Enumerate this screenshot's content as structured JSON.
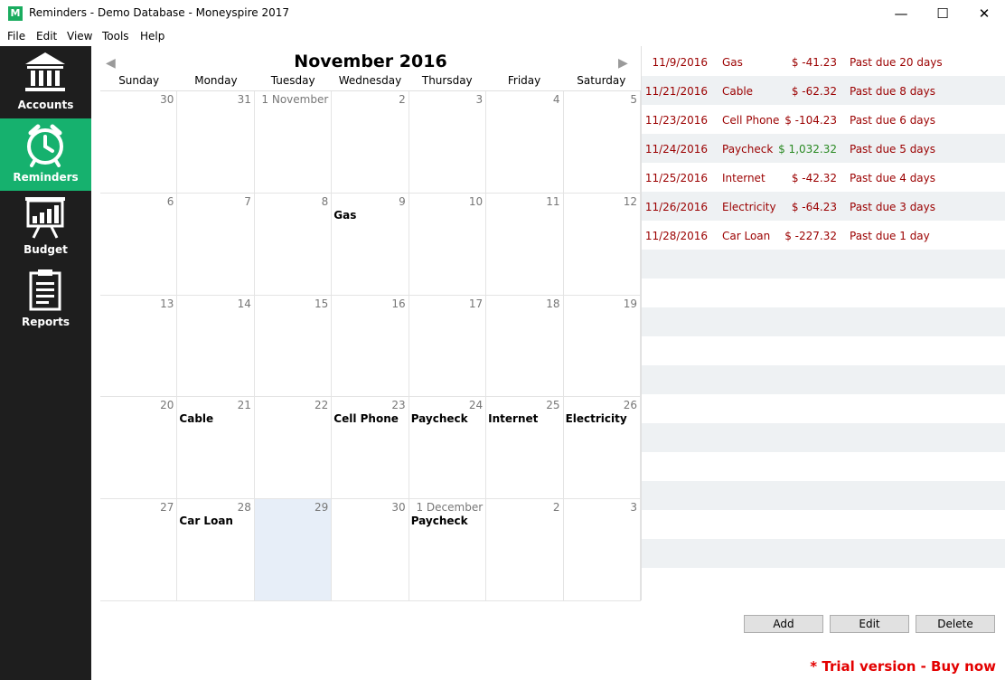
{
  "window": {
    "title": "Reminders - Demo Database - Moneyspire 2017",
    "app_icon_letter": "M",
    "minimize_glyph": "—",
    "maximize_glyph": "☐",
    "close_glyph": "✕"
  },
  "menu": [
    "File",
    "Edit",
    "View",
    "Tools",
    "Help"
  ],
  "sidebar": {
    "items": [
      {
        "label": "Accounts",
        "icon": "bank-icon",
        "active": false
      },
      {
        "label": "Reminders",
        "icon": "alarm-clock-icon",
        "active": true
      },
      {
        "label": "Budget",
        "icon": "presentation-chart-icon",
        "active": false
      },
      {
        "label": "Reports",
        "icon": "clipboard-icon",
        "active": false
      }
    ]
  },
  "calendar": {
    "month_title": "November 2016",
    "prev_arrow": "◀",
    "next_arrow": "▶",
    "weekdays": [
      "Sunday",
      "Monday",
      "Tuesday",
      "Wednesday",
      "Thursday",
      "Friday",
      "Saturday"
    ],
    "cells": [
      {
        "day": "30",
        "event": ""
      },
      {
        "day": "31",
        "event": ""
      },
      {
        "day": "1 November",
        "event": ""
      },
      {
        "day": "2",
        "event": ""
      },
      {
        "day": "3",
        "event": ""
      },
      {
        "day": "4",
        "event": ""
      },
      {
        "day": "5",
        "event": ""
      },
      {
        "day": "6",
        "event": ""
      },
      {
        "day": "7",
        "event": ""
      },
      {
        "day": "8",
        "event": ""
      },
      {
        "day": "9",
        "event": "Gas"
      },
      {
        "day": "10",
        "event": ""
      },
      {
        "day": "11",
        "event": ""
      },
      {
        "day": "12",
        "event": ""
      },
      {
        "day": "13",
        "event": ""
      },
      {
        "day": "14",
        "event": ""
      },
      {
        "day": "15",
        "event": ""
      },
      {
        "day": "16",
        "event": ""
      },
      {
        "day": "17",
        "event": ""
      },
      {
        "day": "18",
        "event": ""
      },
      {
        "day": "19",
        "event": ""
      },
      {
        "day": "20",
        "event": ""
      },
      {
        "day": "21",
        "event": "Cable"
      },
      {
        "day": "22",
        "event": ""
      },
      {
        "day": "23",
        "event": "Cell Phone"
      },
      {
        "day": "24",
        "event": "Paycheck"
      },
      {
        "day": "25",
        "event": "Internet"
      },
      {
        "day": "26",
        "event": "Electricity"
      },
      {
        "day": "27",
        "event": ""
      },
      {
        "day": "28",
        "event": "Car Loan"
      },
      {
        "day": "29",
        "event": "",
        "today": true
      },
      {
        "day": "30",
        "event": ""
      },
      {
        "day": "1 December",
        "event": "Paycheck"
      },
      {
        "day": "2",
        "event": ""
      },
      {
        "day": "3",
        "event": ""
      }
    ]
  },
  "reminders": [
    {
      "date": "11/9/2016",
      "name": "Gas",
      "amount": "$ -41.23",
      "status": "Past due 20 days",
      "positive": false
    },
    {
      "date": "11/21/2016",
      "name": "Cable",
      "amount": "$ -62.32",
      "status": "Past due 8 days",
      "positive": false
    },
    {
      "date": "11/23/2016",
      "name": "Cell Phone",
      "amount": "$ -104.23",
      "status": "Past due 6 days",
      "positive": false
    },
    {
      "date": "11/24/2016",
      "name": "Paycheck",
      "amount": "$ 1,032.32",
      "status": "Past due 5 days",
      "positive": true
    },
    {
      "date": "11/25/2016",
      "name": "Internet",
      "amount": "$ -42.32",
      "status": "Past due 4 days",
      "positive": false
    },
    {
      "date": "11/26/2016",
      "name": "Electricity",
      "amount": "$ -64.23",
      "status": "Past due 3 days",
      "positive": false
    },
    {
      "date": "11/28/2016",
      "name": "Car Loan",
      "amount": "$ -227.32",
      "status": "Past due 1 day",
      "positive": false
    }
  ],
  "buttons": {
    "add": "Add",
    "edit": "Edit",
    "delete": "Delete"
  },
  "trial_text": "* Trial version - Buy now",
  "colors": {
    "accent": "#16b16e",
    "sidebar_bg": "#1e1e1e",
    "due_text": "#9b0000",
    "positive_amount": "#2a8a23",
    "trial": "#e30000"
  }
}
